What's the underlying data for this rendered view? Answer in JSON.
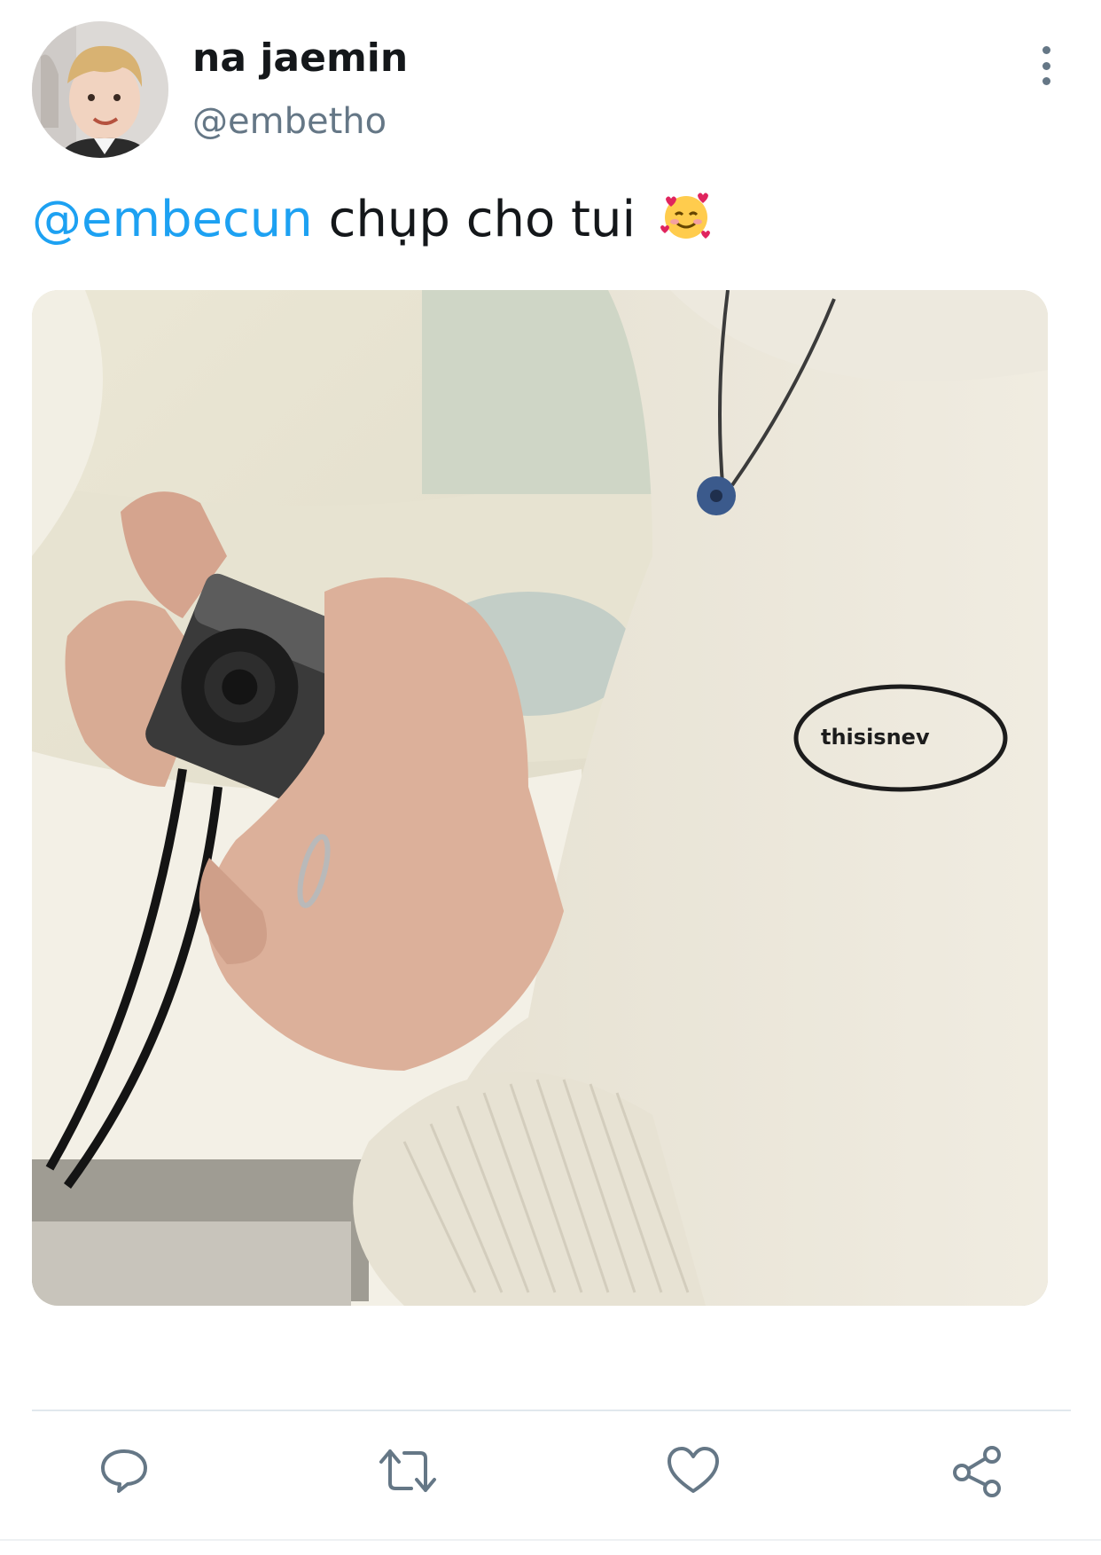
{
  "tweet": {
    "author_name": "na jaemin",
    "author_handle": "@embetho",
    "mention": "@embecun",
    "text": "chụp cho tui",
    "emoji": "smiling-face-with-hearts-icon",
    "media_caption_text": "thisisnev"
  },
  "actions": [
    {
      "name": "reply",
      "icon": "reply-icon"
    },
    {
      "name": "retweet",
      "icon": "retweet-icon"
    },
    {
      "name": "like",
      "icon": "heart-icon"
    },
    {
      "name": "share",
      "icon": "share-icon"
    }
  ],
  "colors": {
    "accent": "#1da1f2",
    "icon": "#657786",
    "text": "#14171a"
  }
}
